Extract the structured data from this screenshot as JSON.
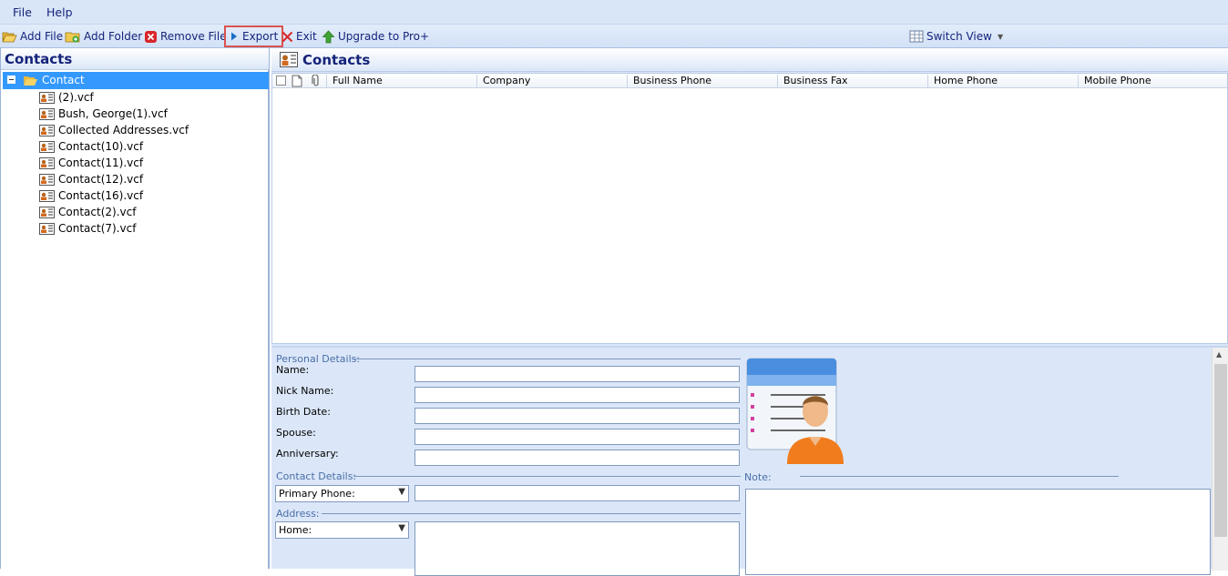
{
  "menu": {
    "items": [
      "File",
      "Help"
    ]
  },
  "toolbar": {
    "add_file": "Add File",
    "add_folder": "Add Folder",
    "remove_file": "Remove File",
    "export": "Export",
    "exit": "Exit",
    "upgrade": "Upgrade to Pro+",
    "switch_view": "Switch View"
  },
  "left_panel": {
    "title": "Contacts",
    "root": "Contact",
    "items": [
      "(2).vcf",
      "Bush, George(1).vcf",
      "Collected Addresses.vcf",
      "Contact(10).vcf",
      "Contact(11).vcf",
      "Contact(12).vcf",
      "Contact(16).vcf",
      "Contact(2).vcf",
      "Contact(7).vcf"
    ]
  },
  "right_panel": {
    "title": "Contacts",
    "columns": [
      "Full Name",
      "Company",
      "Business Phone",
      "Business Fax",
      "Home Phone",
      "Mobile Phone"
    ]
  },
  "details": {
    "personal_label": "Personal Details:",
    "name_label": "Name:",
    "nick_label": "Nick Name:",
    "birth_label": "Birth Date:",
    "spouse_label": "Spouse:",
    "anniversary_label": "Anniversary:",
    "contact_label": "Contact Details:",
    "phone_select": "Primary Phone:",
    "address_label": "Address:",
    "address_select": "Home:",
    "note_label": "Note:"
  }
}
